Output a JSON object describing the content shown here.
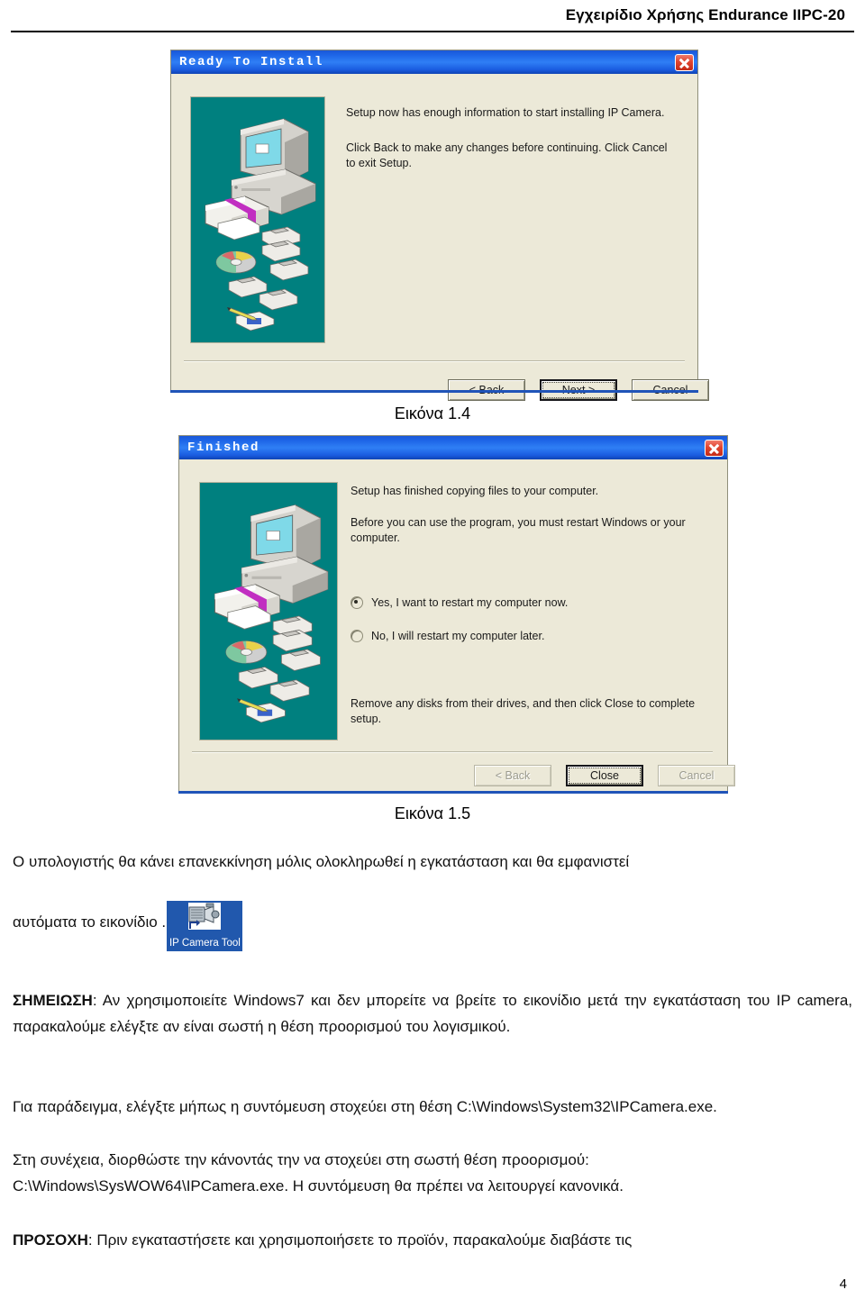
{
  "header": {
    "title": "Εγχειρίδιο Χρήσης Endurance IIPC-20"
  },
  "dialog_ready": {
    "title": "Ready To Install",
    "close_icon": "close-icon",
    "illustration": "setup-computer-media-illustration",
    "body_line1": "Setup now has enough information to start installing IP Camera.",
    "body_line2": "Click Back to make any changes before continuing. Click Cancel to exit Setup.",
    "buttons": {
      "back": "< Back",
      "next": "Next >",
      "cancel": "Cancel"
    },
    "caption": "Εικόνα 1.4"
  },
  "dialog_finished": {
    "title": "Finished",
    "close_icon": "close-icon",
    "illustration": "setup-computer-media-illustration",
    "body_line1": "Setup has finished copying files to your computer.",
    "body_line2": "Before you can use the program, you must restart Windows or your computer.",
    "radio_yes": "Yes, I want to restart my computer now.",
    "radio_no": "No, I will restart my computer later.",
    "footer_text": "Remove any disks from their drives, and then click Close to complete setup.",
    "buttons": {
      "back": "< Back",
      "close": "Close",
      "cancel": "Cancel"
    },
    "caption": "Εικόνα 1.5"
  },
  "content": {
    "para1": "Ο υπολογιστής θα κάνει επανεκκίνηση μόλις ολοκληρωθεί η εγκατάσταση και θα εμφανιστεί",
    "para2_before": "αυτόματα το εικονίδιο",
    "para2_after": ".",
    "desktop_icon_label": "IP Camera Tool",
    "note_label": "ΣΗΜΕΙΩΣΗ",
    "note_text": ": Αν χρησιμοποιείτε Windows7 και δεν μπορείτε να βρείτε το εικονίδιο μετά την εγκατάσταση του IP camera, παρακαλούμε ελέγξτε αν είναι σωστή η θέση προορισμού του λογισμικού.",
    "para3": "Για παράδειγμα, ελέγξτε μήπως η συντόμευση στοχεύει στη θέση C:\\Windows\\System32\\IPCamera.exe.",
    "para4": "Στη συνέχεια, διορθώστε την κάνοντάς την να στοχεύει στη σωστή θέση προορισμού: C:\\Windows\\SysWOW64\\IPCamera.exe. Η συντόμευση θα πρέπει να λειτουργεί κανονικά.",
    "warning_label": "ΠΡΟΣΟΧΗ",
    "warning_text": ": Πριν εγκαταστήσετε και χρησιμοποιήσετε το προϊόν, παρακαλούμε διαβάστε τις"
  },
  "page_number": "4",
  "colors": {
    "titlebar_blue": "#1d64e6",
    "dialog_face": "#ece9d8",
    "illustration_teal": "#00807f",
    "accent_bar": "#2054b8",
    "icon_select_blue": "#2158ad"
  }
}
